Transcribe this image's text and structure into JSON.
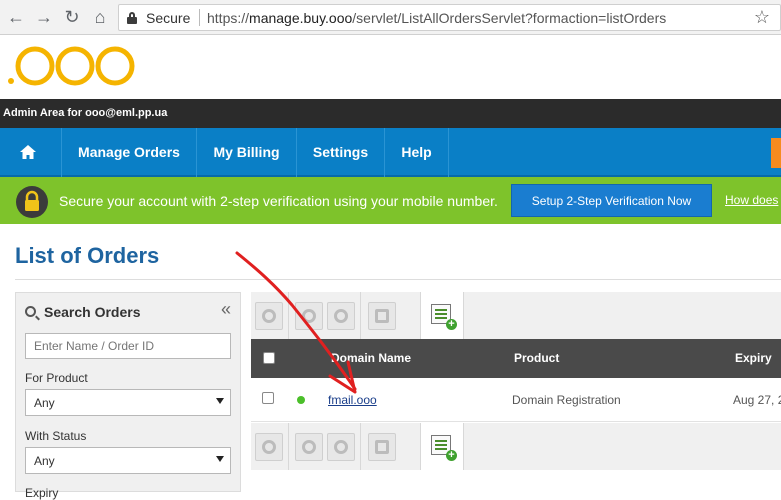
{
  "browser": {
    "secure_label": "Secure",
    "url_scheme": "https://",
    "url_host": "manage.buy.ooo",
    "url_path": "/servlet/ListAllOrdersServlet?formaction=listOrders"
  },
  "brand": {
    "logo_text": ".OOO",
    "logo_color": "#f5b400"
  },
  "admin_bar": {
    "text": "Admin Area for ooo@eml.pp.ua"
  },
  "nav": {
    "items": [
      {
        "label": "Manage Orders"
      },
      {
        "label": "My Billing"
      },
      {
        "label": "Settings"
      },
      {
        "label": "Help"
      }
    ]
  },
  "security_banner": {
    "message": "Secure your account with 2-step verification using your mobile number.",
    "button_label": "Setup 2-Step Verification Now",
    "link_text": "How does"
  },
  "page": {
    "title": "List of Orders"
  },
  "search": {
    "heading": "Search Orders",
    "input_placeholder": "Enter Name / Order ID",
    "product_label": "For Product",
    "product_value": "Any",
    "status_label": "With Status",
    "status_value": "Any",
    "expiry_label": "Expiry"
  },
  "table": {
    "headers": {
      "domain": "Domain Name",
      "product": "Product",
      "expiry": "Expiry"
    },
    "rows": [
      {
        "domain": "fmail.ooo",
        "product": "Domain Registration",
        "expiry": "Aug 27, 2"
      }
    ]
  },
  "colors": {
    "nav_blue": "#0a7fc6",
    "banner_green": "#7ec32b",
    "title_blue": "#1e64a0",
    "annotation_red": "#e02020"
  }
}
